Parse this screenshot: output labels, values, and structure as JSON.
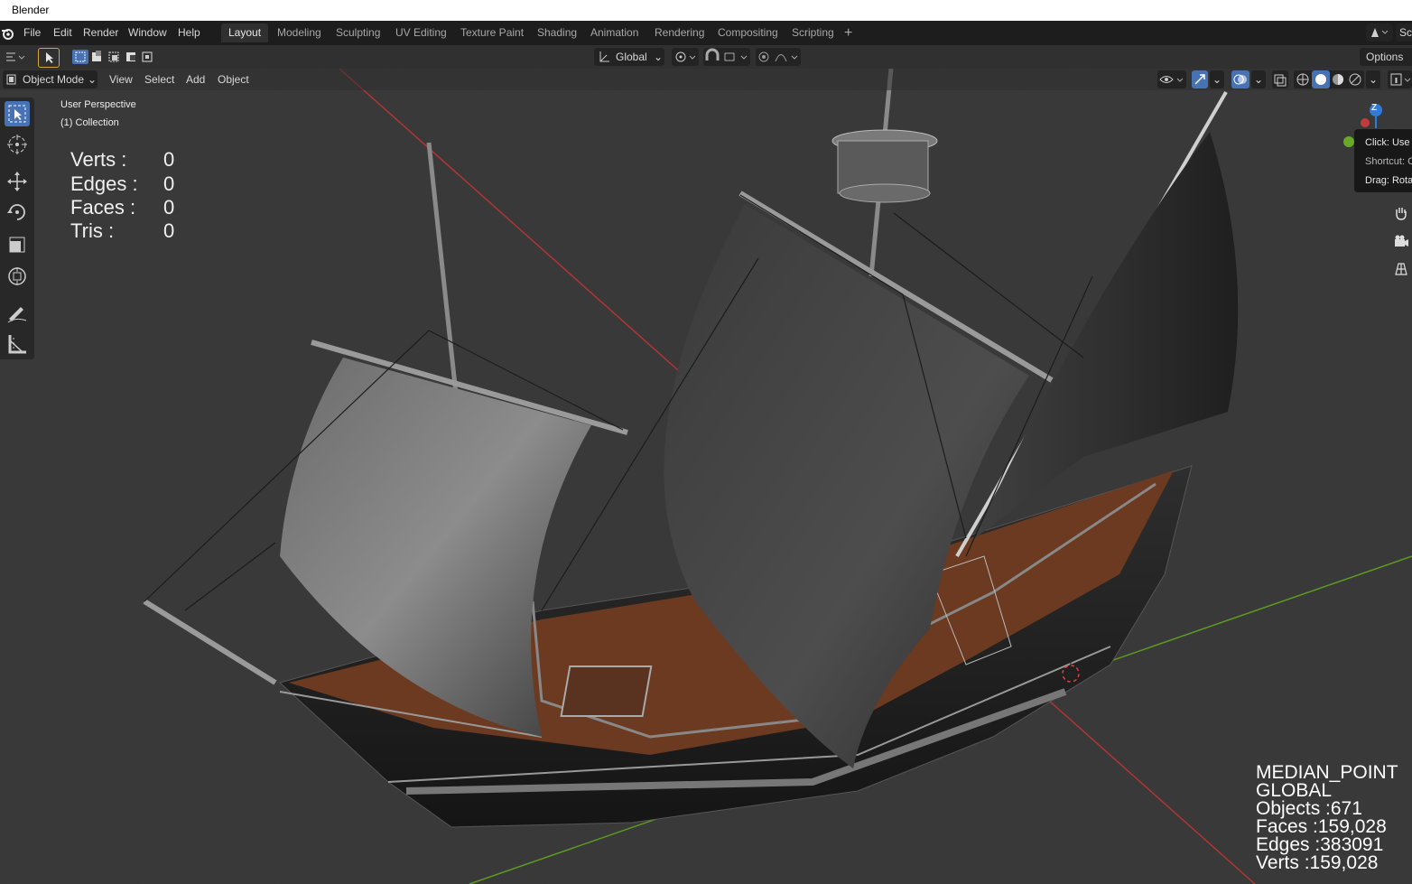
{
  "window": {
    "title": "Blender"
  },
  "menu": [
    "File",
    "Edit",
    "Render",
    "Window",
    "Help"
  ],
  "workspaces": {
    "tabs": [
      "Layout",
      "Modeling",
      "Sculpting",
      "UV Editing",
      "Texture Paint",
      "Shading",
      "Animation",
      "Rendering",
      "Compositing",
      "Scripting"
    ],
    "active": "Layout",
    "add": "+"
  },
  "scene_label": "Sc",
  "toolbar": {
    "transform_orientation": "Global",
    "options": "Options"
  },
  "header": {
    "mode": "Object Mode",
    "menus": [
      "View",
      "Select",
      "Add",
      "Object"
    ]
  },
  "viewport": {
    "view_name": "User Perspective",
    "collection": "(1) Collection",
    "stats": [
      {
        "label": "Verts :",
        "value": "0"
      },
      {
        "label": "Edges :",
        "value": "0"
      },
      {
        "label": "Faces :",
        "value": "0"
      },
      {
        "label": "Tris :",
        "value": "0"
      }
    ],
    "scene_info": [
      "MEDIAN_POINT",
      "GLOBAL",
      "Objects :671",
      "Faces :159,028",
      "Edges :383091",
      "Verts :159,028"
    ],
    "gizmo_axis": "Z"
  },
  "tooltip": {
    "lines": [
      "Click: Use",
      "Shortcut: C",
      "Drag: Rota"
    ]
  },
  "colors": {
    "accent": "#4772b3",
    "x_axis": "#c23b3b",
    "y_axis": "#6aa82a",
    "z_axis": "#2f7bd6"
  }
}
